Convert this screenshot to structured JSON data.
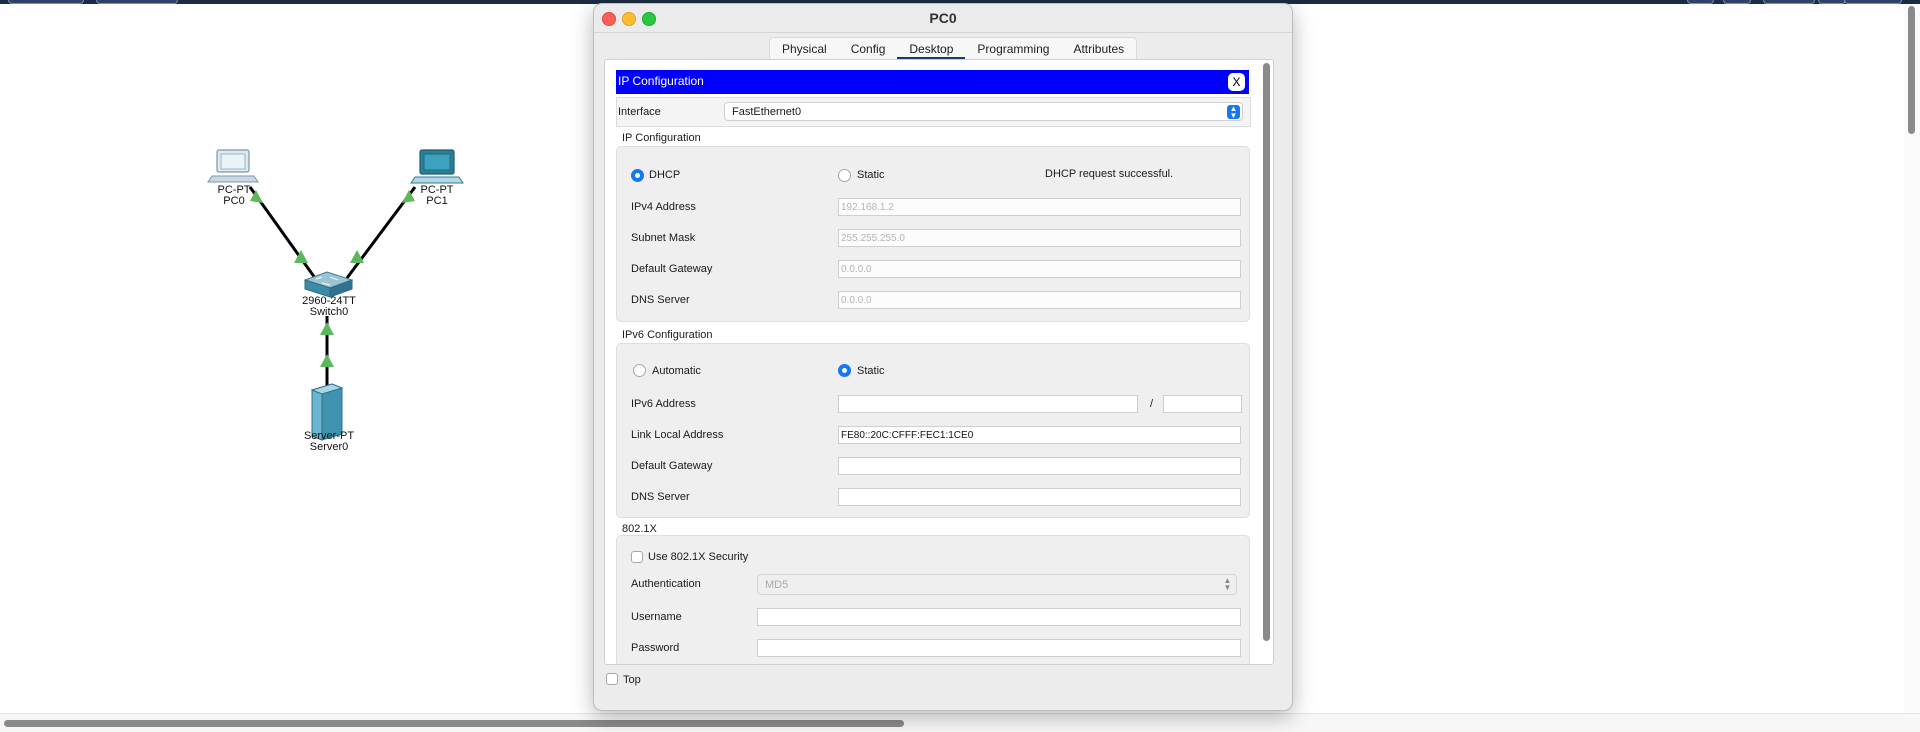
{
  "workspace": {
    "nodes": [
      {
        "type_label": "PC-PT",
        "name": "PC0"
      },
      {
        "type_label": "PC-PT",
        "name": "PC1"
      },
      {
        "type_label": "2960-24TT",
        "name": "Switch0"
      },
      {
        "type_label": "Server-PT",
        "name": "Server0"
      }
    ]
  },
  "window": {
    "title": "PC0",
    "tabs": [
      "Physical",
      "Config",
      "Desktop",
      "Programming",
      "Attributes"
    ],
    "active_tab": "Desktop",
    "app": {
      "title": "IP Configuration",
      "close_label": "X",
      "interface_label": "Interface",
      "interface_value": "FastEthernet0",
      "ipv4": {
        "section_title": "IP Configuration",
        "dhcp_label": "DHCP",
        "static_label": "Static",
        "selected": "DHCP",
        "status": "DHCP request successful.",
        "fields": [
          {
            "label": "IPv4 Address",
            "value": "192.168.1.2"
          },
          {
            "label": "Subnet Mask",
            "value": "255.255.255.0"
          },
          {
            "label": "Default Gateway",
            "value": "0.0.0.0"
          },
          {
            "label": "DNS Server",
            "value": "0.0.0.0"
          }
        ]
      },
      "ipv6": {
        "section_title": "IPv6 Configuration",
        "automatic_label": "Automatic",
        "static_label": "Static",
        "selected": "Static",
        "address_label": "IPv6 Address",
        "address_value": "",
        "slash": "/",
        "prefix_value": "",
        "fields": [
          {
            "label": "Link Local Address",
            "value": "FE80::20C:CFFF:FEC1:1CE0"
          },
          {
            "label": "Default Gateway",
            "value": ""
          },
          {
            "label": "DNS Server",
            "value": ""
          }
        ]
      },
      "dot1x": {
        "section_title": "802.1X",
        "use_label": "Use 802.1X Security",
        "use_checked": false,
        "auth_label": "Authentication",
        "auth_value": "MD5",
        "username_label": "Username",
        "username_value": "",
        "password_label": "Password",
        "password_value": ""
      }
    },
    "top_label": "Top",
    "top_checked": false
  },
  "colors": {
    "app_title_bar": "#0000ff",
    "link": "#000000",
    "link_arrow": "#5cb85c",
    "radio_selected": "#1478f5",
    "tab_active_underline": "#1d3a78"
  }
}
